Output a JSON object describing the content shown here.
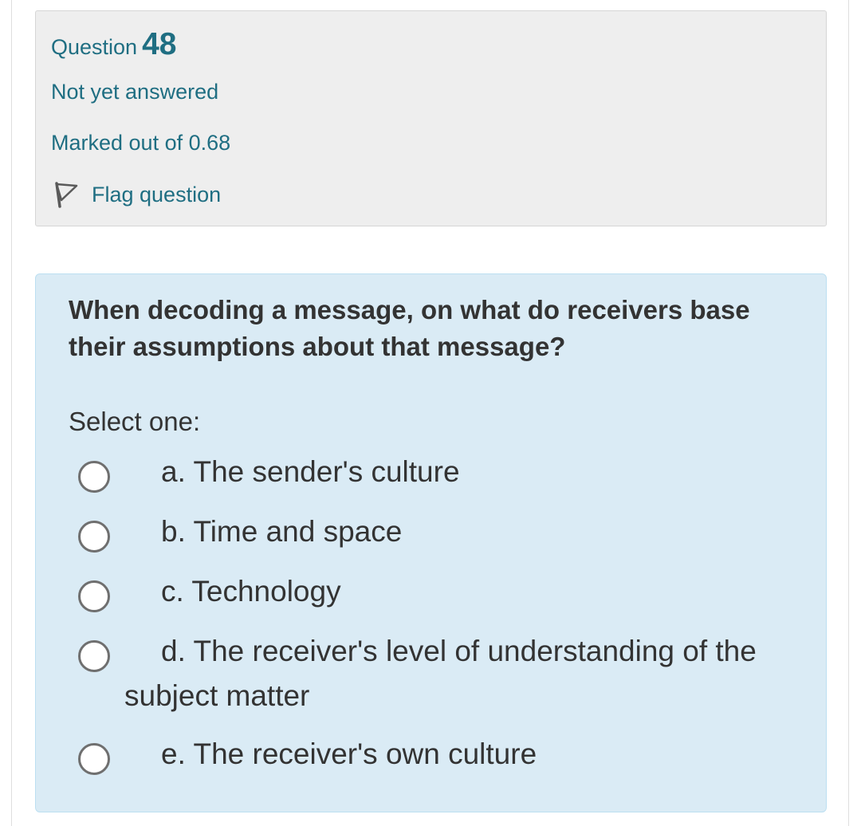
{
  "header": {
    "question_label": "Question",
    "question_number": "48",
    "state": "Not yet answered",
    "grade": "Marked out of 0.68",
    "flag_label": "Flag question"
  },
  "question": {
    "text": "When decoding a message, on what do receivers base their assumptions about that message?",
    "prompt": "Select one:",
    "options": [
      {
        "label": "a. The sender's culture",
        "selected": false
      },
      {
        "label": "b. Time and space",
        "selected": false
      },
      {
        "label": "c. Technology",
        "selected": false
      },
      {
        "label": "d. The receiver's level of understanding of the subject matter",
        "selected": false
      },
      {
        "label": "e. The receiver's own culture",
        "selected": false
      }
    ]
  },
  "colors": {
    "accent": "#1f6e82",
    "info_background": "#eeeeee",
    "content_background": "#daebf5",
    "text": "#333333"
  },
  "icons": {
    "flag": "flag-outline-icon"
  }
}
